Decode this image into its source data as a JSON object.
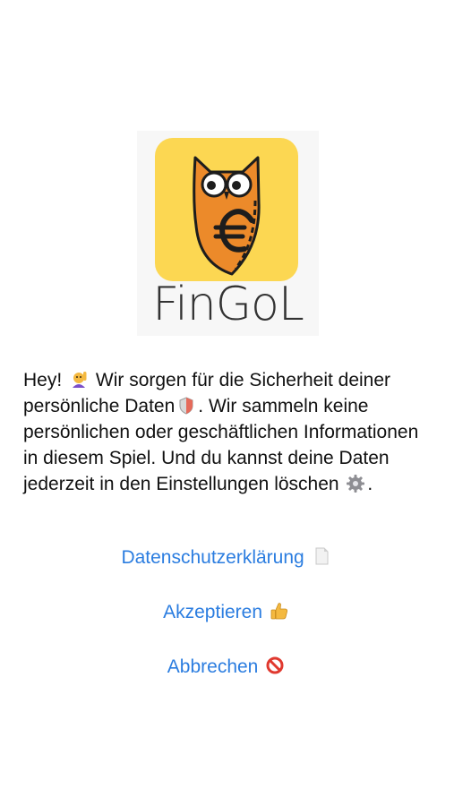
{
  "app": {
    "logo_word": "FinGoL",
    "accent_color": "#2b7de0",
    "icon_background": "#fcd752",
    "icon": "owl-euro-logo"
  },
  "message": {
    "part1": "Hey!",
    "part1_icon": "raising-hand-icon",
    "part2": "Wir sorgen für die Sicherheit deiner persönliche Daten",
    "part2_icon": "shield-icon",
    "part3": ". Wir sammeln keine persönlichen oder geschäftlichen Informationen in diesem Spiel. Und du kannst deine Daten jederzeit in den Einstellungen löschen",
    "part3_icon": "gear-icon",
    "part4": "."
  },
  "actions": {
    "privacy_label": "Datenschutzerklärung",
    "privacy_icon": "document-icon",
    "accept_label": "Akzeptieren",
    "accept_icon": "thumbs-up-icon",
    "cancel_label": "Abbrechen",
    "cancel_icon": "prohibited-icon"
  }
}
